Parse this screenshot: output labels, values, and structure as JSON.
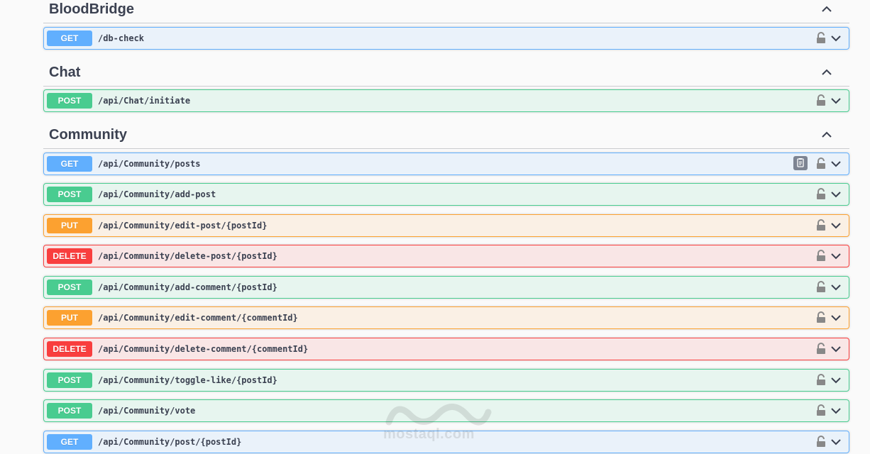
{
  "sections": [
    {
      "title": "BloodBridge",
      "ops": [
        {
          "method": "GET",
          "path": "/db-check"
        }
      ]
    },
    {
      "title": "Chat",
      "ops": [
        {
          "method": "POST",
          "path": "/api/Chat/initiate"
        }
      ]
    },
    {
      "title": "Community",
      "ops": [
        {
          "method": "GET",
          "path": "/api/Community/posts"
        },
        {
          "method": "POST",
          "path": "/api/Community/add-post"
        },
        {
          "method": "PUT",
          "path": "/api/Community/edit-post/{postId}"
        },
        {
          "method": "DELETE",
          "path": "/api/Community/delete-post/{postId}"
        },
        {
          "method": "POST",
          "path": "/api/Community/add-comment/{postId}"
        },
        {
          "method": "PUT",
          "path": "/api/Community/edit-comment/{commentId}"
        },
        {
          "method": "DELETE",
          "path": "/api/Community/delete-comment/{commentId}"
        },
        {
          "method": "POST",
          "path": "/api/Community/toggle-like/{postId}"
        },
        {
          "method": "POST",
          "path": "/api/Community/vote"
        },
        {
          "method": "GET",
          "path": "/api/Community/post/{postId}"
        }
      ]
    }
  ],
  "icons": {
    "lock": "lock-icon",
    "expand": "chevron-down-icon",
    "collapse": "chevron-up-icon",
    "copy": "copy-to-clipboard-icon"
  },
  "watermark": {
    "text": "mostaql.com"
  },
  "colors": {
    "get": "#61affe",
    "post": "#49cc90",
    "put": "#fca130",
    "delete": "#f93e3e"
  }
}
